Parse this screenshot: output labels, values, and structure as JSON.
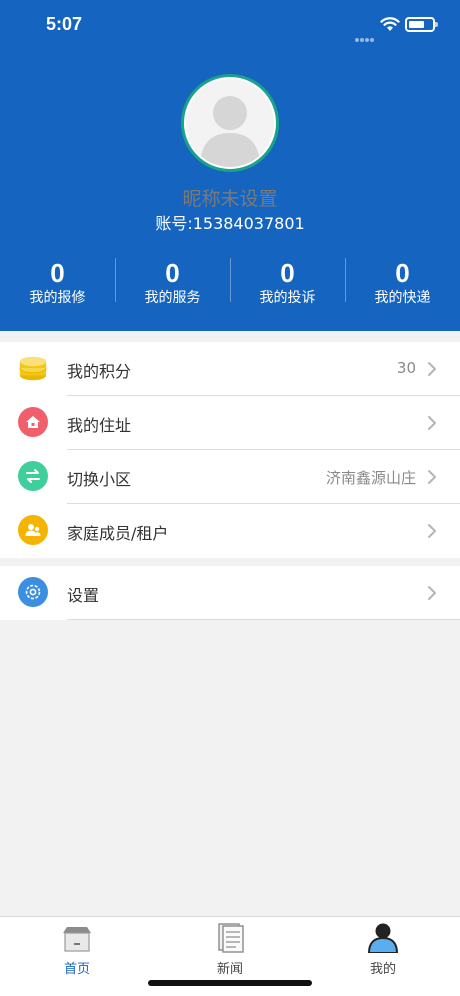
{
  "status_bar": {
    "time": "5:07"
  },
  "profile": {
    "nickname": "昵称未设置",
    "account": "账号:15384037801"
  },
  "stats": [
    {
      "value": "0",
      "label": "我的报修"
    },
    {
      "value": "0",
      "label": "我的服务"
    },
    {
      "value": "0",
      "label": "我的投诉"
    },
    {
      "value": "0",
      "label": "我的快递"
    }
  ],
  "menu": {
    "points": {
      "label": "我的积分",
      "value": "30",
      "icon": "coins-icon",
      "color": "#f5c518"
    },
    "address": {
      "label": "我的住址",
      "icon": "house-icon",
      "color": "#f0606c"
    },
    "switch_community": {
      "label": "切换小区",
      "value": "济南鑫源山庄",
      "icon": "switch-arrows-icon",
      "color": "#3ecf9c"
    },
    "family": {
      "label": "家庭成员/租户",
      "icon": "family-icon",
      "color": "#f4b400"
    },
    "settings": {
      "label": "设置",
      "icon": "gear-icon",
      "color": "#3b8fe0"
    }
  },
  "tabbar": {
    "items": [
      {
        "label": "首页",
        "icon": "home-icon",
        "active": true
      },
      {
        "label": "新闻",
        "icon": "news-icon",
        "active": false
      },
      {
        "label": "我的",
        "icon": "profile-icon",
        "active": false
      }
    ]
  },
  "colors": {
    "header": "#1565c0",
    "accent": "#1565c0"
  }
}
